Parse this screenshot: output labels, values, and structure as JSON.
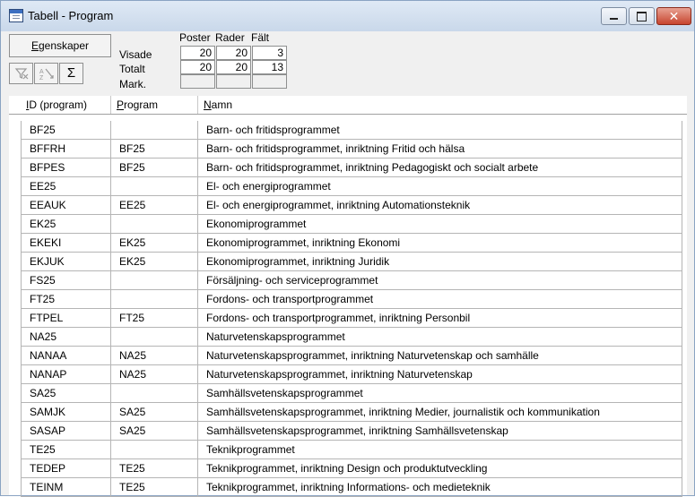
{
  "window": {
    "title": "Tabell - Program"
  },
  "toolbar": {
    "properties_label": "Egenskaper",
    "properties_underline": "E",
    "properties_rest": "genskaper",
    "icons": [
      "filter-off-icon",
      "sort-az-icon",
      "sum-icon"
    ],
    "sum_glyph": "Σ"
  },
  "stats": {
    "columns": [
      "Poster",
      "Rader",
      "Fält"
    ],
    "rows": [
      {
        "label": "Visade",
        "values": [
          "20",
          "20",
          "3"
        ]
      },
      {
        "label": "Totalt",
        "values": [
          "20",
          "20",
          "13"
        ]
      },
      {
        "label": "Mark.",
        "values": [
          "",
          "",
          ""
        ]
      }
    ]
  },
  "table": {
    "headers": [
      {
        "underline": "I",
        "rest": "D (program)"
      },
      {
        "underline": "P",
        "rest": "rogram"
      },
      {
        "underline": "N",
        "rest": "amn"
      }
    ],
    "rows": [
      [
        "BF25",
        "",
        "Barn- och fritidsprogrammet"
      ],
      [
        "BFFRH",
        "BF25",
        "Barn- och fritidsprogrammet, inriktning Fritid och hälsa"
      ],
      [
        "BFPES",
        "BF25",
        "Barn- och fritidsprogrammet, inriktning Pedagogiskt och socialt arbete"
      ],
      [
        "EE25",
        "",
        "El- och energiprogrammet"
      ],
      [
        "EEAUK",
        "EE25",
        "El- och energiprogrammet, inriktning Automationsteknik"
      ],
      [
        "EK25",
        "",
        "Ekonomiprogrammet"
      ],
      [
        "EKEKI",
        "EK25",
        "Ekonomiprogrammet, inriktning Ekonomi"
      ],
      [
        "EKJUK",
        "EK25",
        "Ekonomiprogrammet, inriktning Juridik"
      ],
      [
        "FS25",
        "",
        "Försäljning- och serviceprogrammet"
      ],
      [
        "FT25",
        "",
        "Fordons- och transportprogrammet"
      ],
      [
        "FTPEL",
        "FT25",
        "Fordons- och transportprogrammet, inriktning Personbil"
      ],
      [
        "NA25",
        "",
        "Naturvetenskapsprogrammet"
      ],
      [
        "NANAA",
        "NA25",
        "Naturvetenskapsprogrammet, inriktning Naturvetenskap och samhälle"
      ],
      [
        "NANAP",
        "NA25",
        "Naturvetenskapsprogrammet, inriktning Naturvetenskap"
      ],
      [
        "SA25",
        "",
        "Samhällsvetenskapsprogrammet"
      ],
      [
        "SAMJK",
        "SA25",
        "Samhällsvetenskapsprogrammet, inriktning Medier, journalistik och kommunikation"
      ],
      [
        "SASAP",
        "SA25",
        "Samhällsvetenskapsprogrammet, inriktning Samhällsvetenskap"
      ],
      [
        "TE25",
        "",
        "Teknikprogrammet"
      ],
      [
        "TEDEP",
        "TE25",
        "Teknikprogrammet, inriktning Design och produktutveckling"
      ],
      [
        "TEINM",
        "TE25",
        "Teknikprogrammet, inriktning Informations- och medieteknik"
      ]
    ]
  }
}
